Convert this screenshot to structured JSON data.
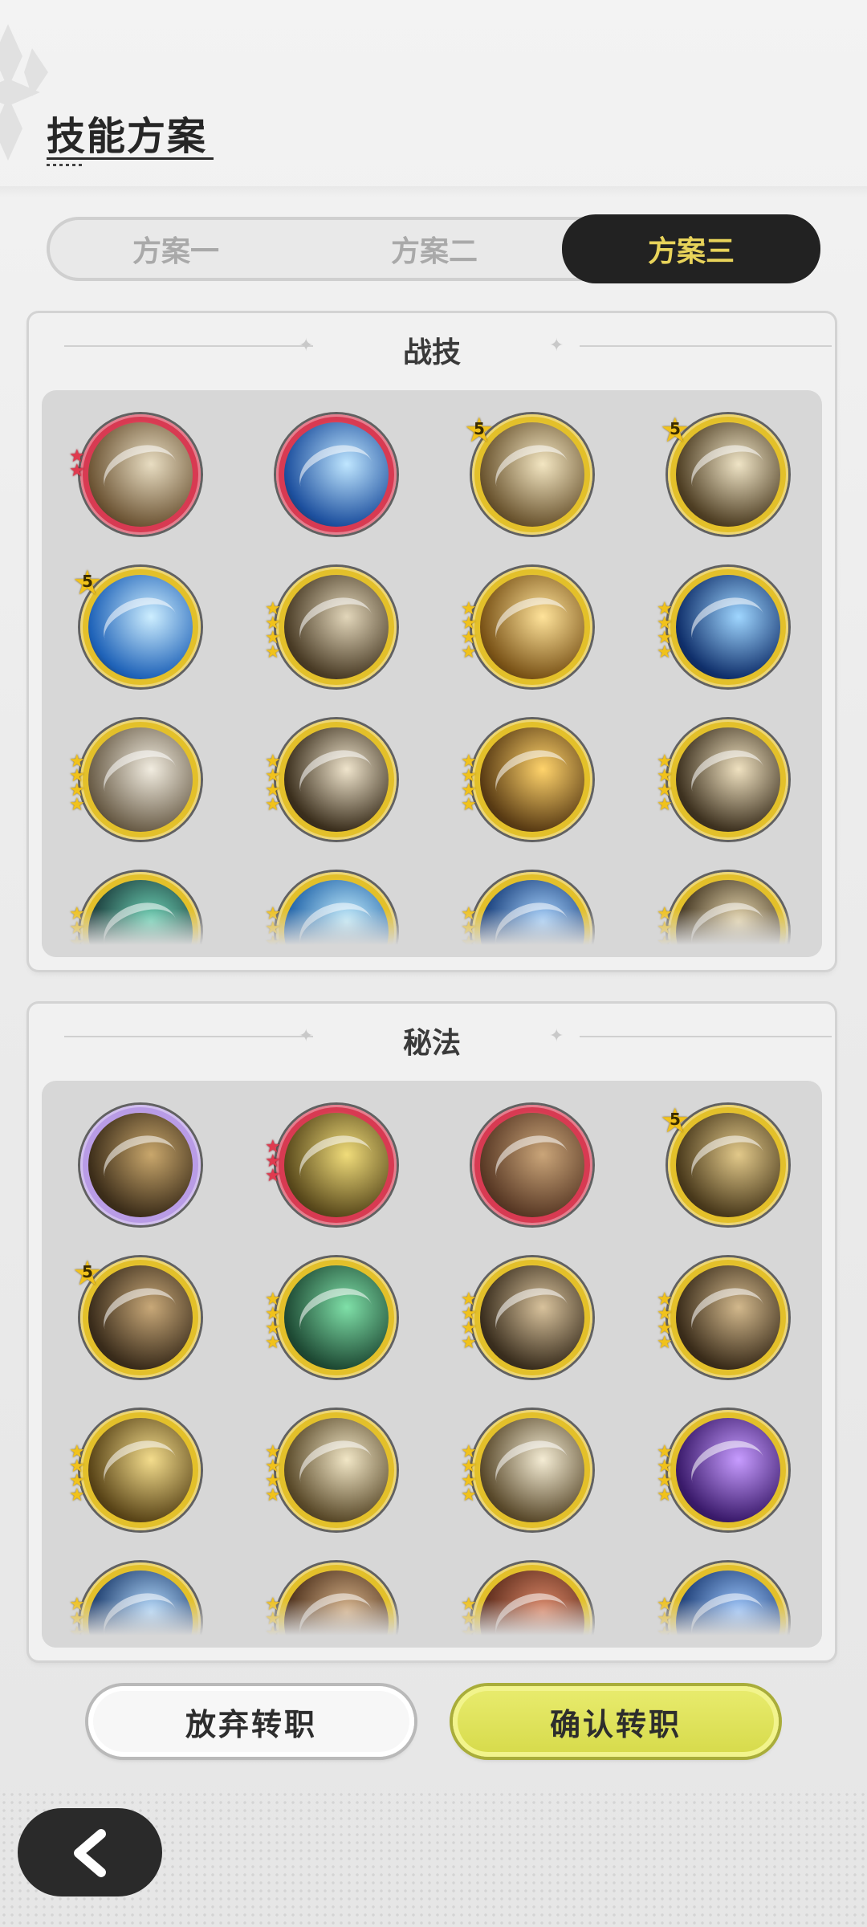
{
  "header": {
    "title": "技能方案"
  },
  "tabs": [
    {
      "label": "方案一",
      "active": false
    },
    {
      "label": "方案二",
      "active": false
    },
    {
      "label": "方案三",
      "active": true
    }
  ],
  "panels": [
    {
      "title": "战技",
      "icons": [
        {
          "name": "swirl-slash-icon",
          "ring": "#d83a52",
          "rank": "red-2",
          "c1": "#e8ddc2",
          "c2": "#6e5636"
        },
        {
          "name": "blue-vortex-icon",
          "ring": "#d83a52",
          "rank": "none",
          "c1": "#bfe6ff",
          "c2": "#1c4f9e"
        },
        {
          "name": "sword-thrust-icon",
          "ring": "#e3c02a",
          "rank": "5",
          "c1": "#f3e6c2",
          "c2": "#6b5530"
        },
        {
          "name": "wind-slash-icon",
          "ring": "#e3c02a",
          "rank": "5",
          "c1": "#efe4c6",
          "c2": "#4f3f24"
        },
        {
          "name": "water-wave-icon",
          "ring": "#e3c02a",
          "rank": "5",
          "c1": "#cdeeff",
          "c2": "#1e62b8"
        },
        {
          "name": "whirlwind-icon",
          "ring": "#e3c02a",
          "rank": "gold-4",
          "c1": "#e2d6ba",
          "c2": "#4a3c26"
        },
        {
          "name": "crescent-moon-icon",
          "ring": "#e3c02a",
          "rank": "gold-4",
          "c1": "#ffe39a",
          "c2": "#7a5317"
        },
        {
          "name": "blue-orb-icon",
          "ring": "#e3c02a",
          "rank": "gold-4",
          "c1": "#9fd6ff",
          "c2": "#0f2f6b"
        },
        {
          "name": "dash-shadow-icon",
          "ring": "#e3c02a",
          "rank": "gold-4",
          "c1": "#f1ece0",
          "c2": "#6c5f4a"
        },
        {
          "name": "kick-strike-icon",
          "ring": "#e3c02a",
          "rank": "gold-4",
          "c1": "#efe4cc",
          "c2": "#3b2f1d"
        },
        {
          "name": "falling-swords-icon",
          "ring": "#e3c02a",
          "rank": "gold-4",
          "c1": "#ffd36b",
          "c2": "#5a3c14"
        },
        {
          "name": "blade-arc-icon",
          "ring": "#e3c02a",
          "rank": "gold-4",
          "c1": "#efe1c0",
          "c2": "#3e3220"
        },
        {
          "name": "green-web-icon",
          "ring": "#e3c02a",
          "rank": "gold-4",
          "c1": "#6fd6b8",
          "c2": "#1a3a3a"
        },
        {
          "name": "ice-shard-icon",
          "ring": "#e3c02a",
          "rank": "gold-4",
          "c1": "#c6f0ff",
          "c2": "#1b5fa6"
        },
        {
          "name": "blue-sigil-icon",
          "ring": "#e3c02a",
          "rank": "gold-4",
          "c1": "#a9d4ff",
          "c2": "#143b78"
        },
        {
          "name": "gold-slash-icon",
          "ring": "#e3c02a",
          "rank": "gold-4",
          "c1": "#e9d9b0",
          "c2": "#3f321e"
        }
      ]
    },
    {
      "title": "秘法",
      "icons": [
        {
          "name": "gathering-figures-icon",
          "ring": "#b99ce6",
          "rank": "none",
          "c1": "#c9a76c",
          "c2": "#3d2e1a"
        },
        {
          "name": "healing-figures-icon",
          "ring": "#d83a52",
          "rank": "red-3",
          "c1": "#f0dc7a",
          "c2": "#5a4a1c"
        },
        {
          "name": "muscle-figure-icon",
          "ring": "#d83a52",
          "rank": "none",
          "c1": "#caa579",
          "c2": "#5a3a26"
        },
        {
          "name": "golden-guardian-icon",
          "ring": "#e3c02a",
          "rank": "5",
          "c1": "#e2c98a",
          "c2": "#4a3a1c"
        },
        {
          "name": "broken-heart-icon",
          "ring": "#e3c02a",
          "rank": "5",
          "c1": "#c8a878",
          "c2": "#3a2c1b"
        },
        {
          "name": "green-cross-icon",
          "ring": "#e3c02a",
          "rank": "gold-4",
          "c1": "#7fe0a8",
          "c2": "#1e4a34"
        },
        {
          "name": "rising-dragon-icon",
          "ring": "#e3c02a",
          "rank": "gold-4",
          "c1": "#d8c29c",
          "c2": "#3a2e1e"
        },
        {
          "name": "spear-burst-icon",
          "ring": "#e3c02a",
          "rank": "gold-4",
          "c1": "#d2b88c",
          "c2": "#3a2c1a"
        },
        {
          "name": "hex-shield-icon",
          "ring": "#e3c02a",
          "rank": "gold-4",
          "c1": "#f3dc8c",
          "c2": "#5a4518"
        },
        {
          "name": "shield-icon",
          "ring": "#e3c02a",
          "rank": "gold-4",
          "c1": "#f1e6c6",
          "c2": "#5a4a2a"
        },
        {
          "name": "eye-icon",
          "ring": "#e3c02a",
          "rank": "gold-4",
          "c1": "#f4ecd4",
          "c2": "#5a4a2c"
        },
        {
          "name": "purple-rune-icon",
          "ring": "#e3c02a",
          "rank": "gold-4",
          "c1": "#c79cff",
          "c2": "#3a1a6b"
        },
        {
          "name": "lightning-cross-icon",
          "ring": "#e3c02a",
          "rank": "gold-4",
          "c1": "#b6dcff",
          "c2": "#1a3a6b"
        },
        {
          "name": "emblem-shield-icon",
          "ring": "#e3c02a",
          "rank": "gold-4",
          "c1": "#d9b48a",
          "c2": "#4a2e1a"
        },
        {
          "name": "red-rock-icon",
          "ring": "#e3c02a",
          "rank": "gold-4",
          "c1": "#e08a6a",
          "c2": "#5a2a1a"
        },
        {
          "name": "blue-shield-icon",
          "ring": "#e3c02a",
          "rank": "gold-4",
          "c1": "#9ec8ff",
          "c2": "#1a3a72"
        }
      ]
    }
  ],
  "buttons": {
    "cancel": "放弃转职",
    "confirm": "确认转职"
  },
  "nav": {
    "back_icon": "chevron-left-icon"
  }
}
